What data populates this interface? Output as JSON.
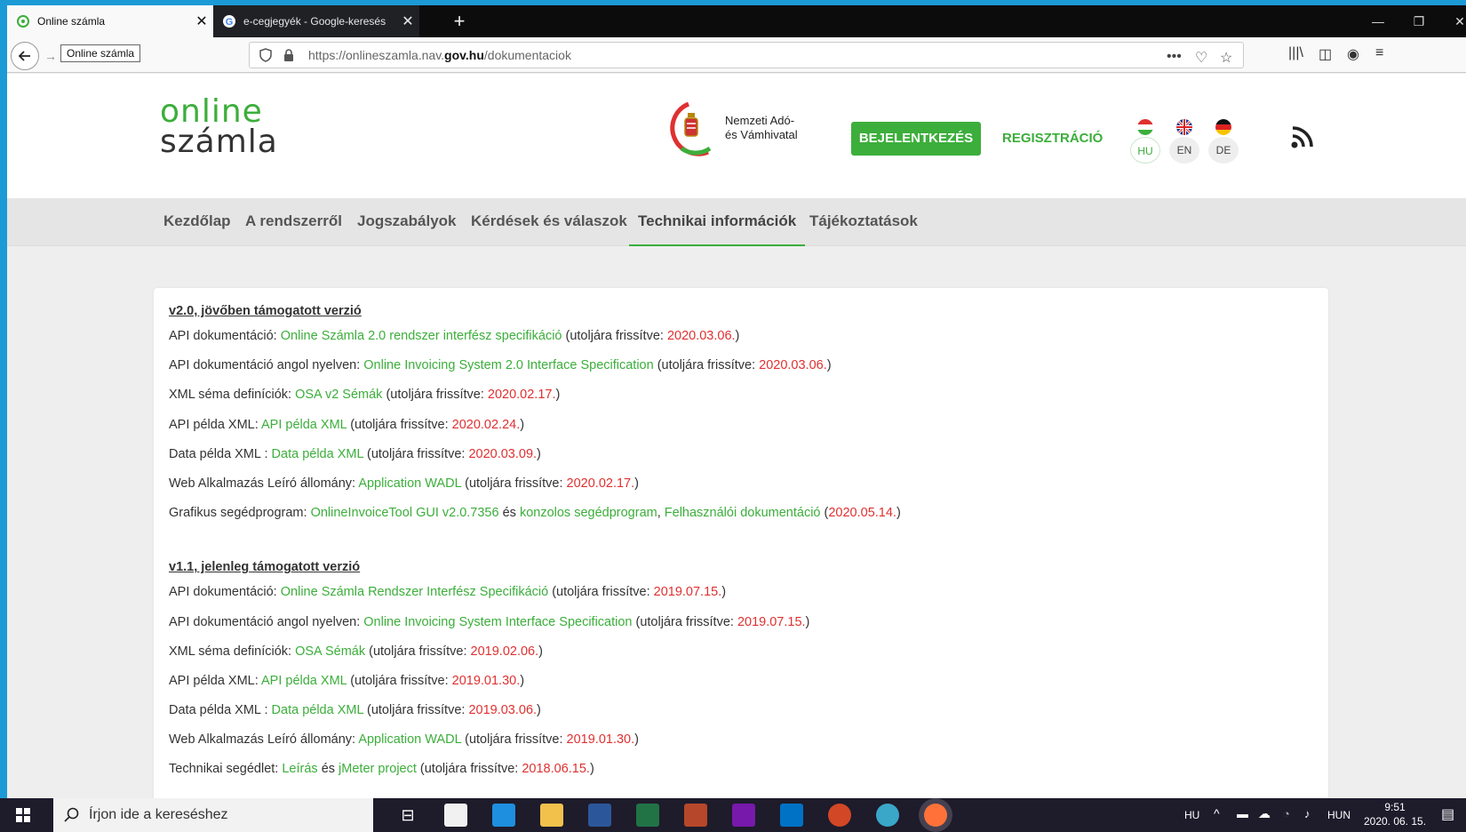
{
  "browser": {
    "tabs": [
      {
        "label": "Online számla",
        "active": true
      },
      {
        "label": "e-cegjegyék - Google-keresés",
        "active": false
      }
    ],
    "tooltip": "Online számla",
    "url_prefix": "https://onlineszamla.nav.",
    "url_domain": "gov.hu",
    "url_path": "/dokumentaciok"
  },
  "site": {
    "logo_line1": "online",
    "logo_line2": "számla",
    "authority_line1": "Nemzeti Adó-",
    "authority_line2": "és Vámhivatal",
    "login_label": "BEJELENTKEZÉS",
    "register_label": "REGISZTRÁCIÓ",
    "languages": [
      "HU",
      "EN",
      "DE"
    ]
  },
  "nav": {
    "items": [
      "Kezdőlap",
      "A rendszerről",
      "Jogszabályok",
      "Kérdések és válaszok",
      "Technikai információk",
      "Tájékoztatások"
    ],
    "active": "Technikai információk"
  },
  "content": {
    "sections": [
      {
        "title": "v2.0, jövőben támogatott verzió",
        "rows": [
          {
            "label": "API dokumentáció: ",
            "link": "Online Számla 2.0 rendszer interfész specifikáció",
            "prefix": " (utoljára frissítve: ",
            "date": "2020.03.06.",
            "suffix": ")"
          },
          {
            "label": "API dokumentáció angol nyelven: ",
            "link": "Online Invoicing System 2.0 Interface Specification",
            "prefix": " (utoljára frissítve: ",
            "date": "2020.03.06.",
            "suffix": ")"
          },
          {
            "label": "XML séma definíciók: ",
            "link": "OSA v2 Sémák",
            "prefix": " (utoljára frissítve: ",
            "date": "2020.02.17.",
            "suffix": ")"
          },
          {
            "label": "API példa XML: ",
            "link": "API példa XML",
            "prefix": " (utoljára frissítve: ",
            "date": "2020.02.24.",
            "suffix": ")"
          },
          {
            "label": "Data példa XML : ",
            "link": "Data példa XML",
            "prefix": " (utoljára frissítve: ",
            "date": "2020.03.09.",
            "suffix": ")"
          },
          {
            "label": "Web Alkalmazás Leíró állomány: ",
            "link": "Application WADL",
            "prefix": " (utoljára frissítve: ",
            "date": "2020.02.17.",
            "suffix": ")"
          }
        ],
        "tool_row": {
          "label": "Grafikus segédprogram: ",
          "link1": "OnlineInvoiceTool GUI v2.0.7356",
          "and": " és ",
          "link2": "konzolos segédprogram",
          "comma": ", ",
          "link3": "Felhasználói dokumentáció",
          "prefix": " (",
          "date": "2020.05.14.",
          "suffix": ")"
        }
      },
      {
        "title": "v1.1, jelenleg támogatott verzió",
        "rows": [
          {
            "label": "API dokumentáció: ",
            "link": "Online Számla Rendszer Interfész Specifikáció",
            "prefix": " (utoljára frissítve: ",
            "date": "2019.07.15.",
            "suffix": ")"
          },
          {
            "label": "API dokumentáció angol nyelven: ",
            "link": "Online Invoicing System Interface Specification",
            "prefix": " (utoljára frissítve: ",
            "date": "2019.07.15.",
            "suffix": ")"
          },
          {
            "label": "XML séma definíciók: ",
            "link": "OSA Sémák",
            "prefix": " (utoljára frissítve: ",
            "date": "2019.02.06.",
            "suffix": ")"
          },
          {
            "label": "API példa XML: ",
            "link": "API példa XML",
            "prefix": " (utoljára frissítve: ",
            "date": "2019.01.30.",
            "suffix": ")"
          },
          {
            "label": "Data példa XML : ",
            "link": "Data példa XML",
            "prefix": " (utoljára frissítve: ",
            "date": "2019.03.06.",
            "suffix": ")"
          },
          {
            "label": "Web Alkalmazás Leíró állomány: ",
            "link": "Application WADL",
            "prefix": " (utoljára frissítve: ",
            "date": "2019.01.30.",
            "suffix": ")"
          }
        ],
        "tech_row": {
          "label": "Technikai segédlet: ",
          "link1": "Leírás",
          "and": " és ",
          "link2": "jMeter project",
          "prefix": " (utoljára frissítve: ",
          "date": "2018.06.15.",
          "suffix": ")"
        }
      }
    ]
  },
  "taskbar": {
    "search_placeholder": "Írjon ide a kereséshez",
    "lang": "HU",
    "keyboard": "HUN",
    "time": "9:51",
    "date": "2020. 06. 15."
  },
  "colors": {
    "accent_green": "#3cae3b",
    "date_red": "#e03030",
    "desktop_blue": "#1c9ad6"
  }
}
